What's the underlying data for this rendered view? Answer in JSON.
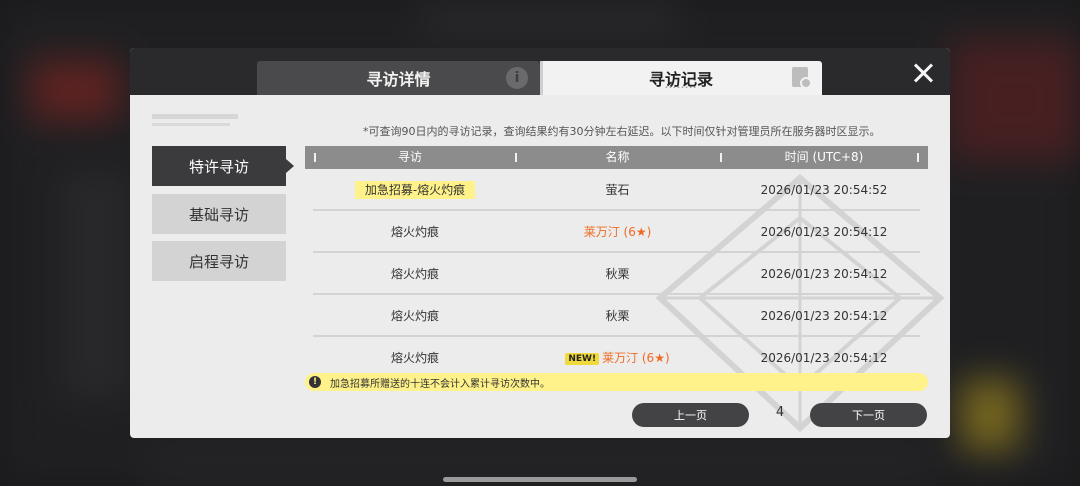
{
  "tabs": {
    "details_label": "寻访详情",
    "records_label": "寻访记录",
    "info_icon_glyph": "i"
  },
  "side_menu": {
    "items": [
      "特许寻访",
      "基础寻访",
      "启程寻访"
    ],
    "active_index": 0
  },
  "notice": "*可查询90日内的寻访记录，查询结果约有30分钟左右延迟。以下时间仅针对管理员所在服务器时区显示。",
  "table": {
    "headers": [
      "寻访",
      "名称",
      "时间 (UTC+8)"
    ],
    "rows": [
      {
        "pool": "加急招募-熔火灼痕",
        "pool_highlight": true,
        "name": "萤石",
        "name_rarity6": false,
        "is_new": false,
        "time": "2026/01/23 20:54:52"
      },
      {
        "pool": "熔火灼痕",
        "pool_highlight": false,
        "name": "莱万汀 (6★)",
        "name_rarity6": true,
        "is_new": false,
        "time": "2026/01/23 20:54:12"
      },
      {
        "pool": "熔火灼痕",
        "pool_highlight": false,
        "name": "秋栗",
        "name_rarity6": false,
        "is_new": false,
        "time": "2026/01/23 20:54:12"
      },
      {
        "pool": "熔火灼痕",
        "pool_highlight": false,
        "name": "秋栗",
        "name_rarity6": false,
        "is_new": false,
        "time": "2026/01/23 20:54:12"
      },
      {
        "pool": "熔火灼痕",
        "pool_highlight": false,
        "name": "莱万汀 (6★)",
        "name_rarity6": true,
        "is_new": true,
        "time": "2026/01/23 20:54:12"
      }
    ],
    "new_badge": "NEW!"
  },
  "tip": {
    "icon_glyph": "!",
    "text": "加急招募所赠送的十连不会计入累计寻访次数中。"
  },
  "pager": {
    "prev_label": "上一页",
    "next_label": "下一页",
    "current_page": "4"
  },
  "colors": {
    "highlight": "#fff28a",
    "rarity6": "#ef6b22",
    "dark_button": "#434345",
    "header_bg": "#8c8c8c"
  }
}
